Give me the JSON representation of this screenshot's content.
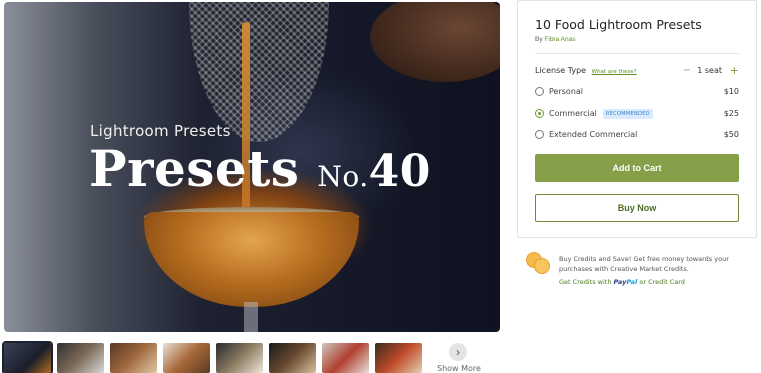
{
  "hero": {
    "subtitle": "Lightroom Presets",
    "title_word": "Presets",
    "title_no": "No.",
    "title_num": "40"
  },
  "gallery": {
    "thumb_count": 8,
    "show_more_label": "Show More",
    "show_more_icon": "chevron-right-icon"
  },
  "product": {
    "title": "10 Food Lightroom Presets",
    "by_prefix": "By",
    "author": "Fibra Anas",
    "license": {
      "label": "License Type",
      "help_link": "What are these?",
      "seat_count": "1 seat",
      "minus_icon": "−",
      "plus_icon": "+",
      "options": [
        {
          "label": "Personal",
          "price": "$10",
          "selected": false
        },
        {
          "label": "Commercial",
          "price": "$25",
          "selected": true,
          "badge": "RECOMMENDED"
        },
        {
          "label": "Extended Commercial",
          "price": "$50",
          "selected": false
        }
      ]
    },
    "add_to_cart": "Add to Cart",
    "buy_now": "Buy Now"
  },
  "credits": {
    "text": "Buy Credits and Save! Get free money towards your purchases with Creative Market Credits.",
    "link_prefix": "Get Credits with",
    "paypal_a": "Pay",
    "paypal_b": "Pal",
    "link_suffix": "or Credit Card",
    "icon": "coins-icon"
  },
  "colors": {
    "accent_green": "#86a04a",
    "link_green": "#5f8c2a",
    "badge_blue": "#d9ecff"
  }
}
